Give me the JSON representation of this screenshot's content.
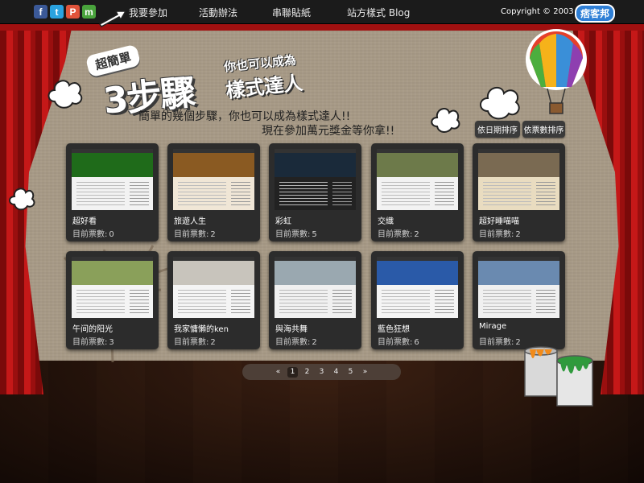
{
  "topbar": {
    "social": [
      {
        "icon": "facebook-icon",
        "glyph": "f"
      },
      {
        "icon": "twitter-icon",
        "glyph": "t"
      },
      {
        "icon": "plurk-icon",
        "glyph": "P"
      },
      {
        "icon": "mixi-icon",
        "glyph": "m"
      }
    ],
    "nav": [
      {
        "label": "我要參加"
      },
      {
        "label": "活動辦法"
      },
      {
        "label": "串聯貼紙"
      },
      {
        "label": "站方樣式  Blog"
      }
    ],
    "copyright": "Copyright © 2003 - 2010",
    "brand": "痞客邦"
  },
  "heading": {
    "tag": "超簡單",
    "big": "3步驟",
    "sub1": "你也可以成為",
    "sub2": "樣式達人",
    "tagline_1": "簡單的幾個步驟，你也可以成為樣式達人!!",
    "tagline_2": "現在參加萬元獎金等你拿!!"
  },
  "sort": {
    "by_date": "依日期排序",
    "by_votes": "依票數排序"
  },
  "vote_label": "目前票數:",
  "entries": [
    {
      "title": "超好看",
      "votes": "0",
      "hero": "#1f6b1a",
      "bg": "#f2f2f2"
    },
    {
      "title": "旅遊人生",
      "votes": "2",
      "hero": "#8a5a22",
      "bg": "#f0e6d6"
    },
    {
      "title": "彩虹",
      "votes": "5",
      "hero": "#1a2a3a",
      "bg": "#222222"
    },
    {
      "title": "交織",
      "votes": "2",
      "hero": "#6d7a4a",
      "bg": "#f2f2f2"
    },
    {
      "title": "超好睡喵喵",
      "votes": "2",
      "hero": "#7a6a52",
      "bg": "#e9dcc0"
    },
    {
      "title": "午间的阳光",
      "votes": "3",
      "hero": "#8aa05a",
      "bg": "#f4f4f4"
    },
    {
      "title": "我家慵懶的ken",
      "votes": "2",
      "hero": "#c8c4bc",
      "bg": "#f4f4f4"
    },
    {
      "title": "與海共舞",
      "votes": "2",
      "hero": "#9aa8b0",
      "bg": "#f0f0f0"
    },
    {
      "title": "藍色狂想",
      "votes": "6",
      "hero": "#2a5aa8",
      "bg": "#f4f4f4"
    },
    {
      "title": "Mirage",
      "votes": "2",
      "hero": "#6a8ab0",
      "bg": "#f0f0f0"
    }
  ],
  "pagination": {
    "prev": "«",
    "pages": [
      "1",
      "2",
      "3",
      "4",
      "5"
    ],
    "current": "1",
    "next": "»"
  }
}
